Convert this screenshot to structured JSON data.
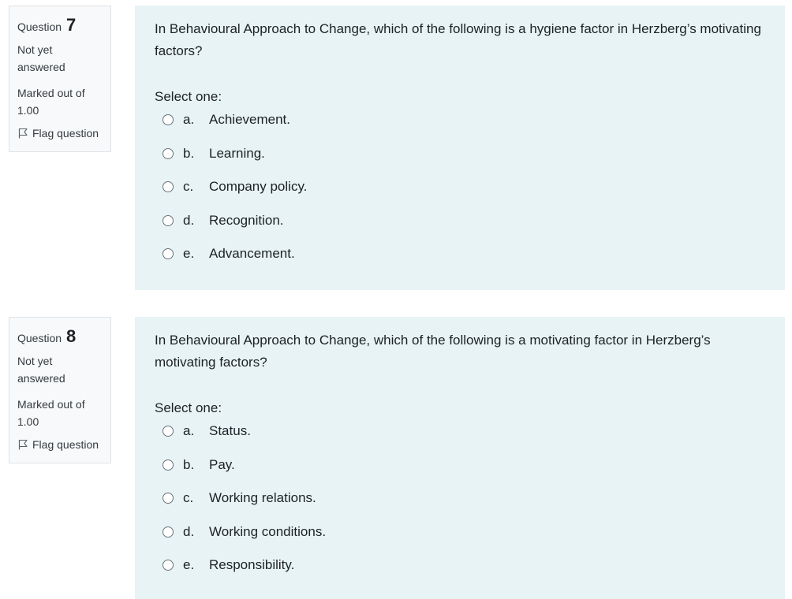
{
  "questions": [
    {
      "word": "Question",
      "number": "7",
      "state": "Not yet answered",
      "grade": "Marked out of 1.00",
      "flag_label": "Flag question",
      "text": "In Behavioural Approach to Change, which of the following is a hygiene factor in Herzberg’s motivating factors?",
      "prompt": "Select one:",
      "answers": [
        {
          "letter": "a.",
          "text": "Achievement."
        },
        {
          "letter": "b.",
          "text": "Learning."
        },
        {
          "letter": "c.",
          "text": "Company policy."
        },
        {
          "letter": "d.",
          "text": "Recognition."
        },
        {
          "letter": "e.",
          "text": "Advancement."
        }
      ]
    },
    {
      "word": "Question",
      "number": "8",
      "state": "Not yet answered",
      "grade": "Marked out of 1.00",
      "flag_label": "Flag question",
      "text": "In Behavioural Approach to Change, which of the following is a motivating factor in Herzberg’s motivating factors?",
      "prompt": "Select one:",
      "answers": [
        {
          "letter": "a.",
          "text": "Status."
        },
        {
          "letter": "b.",
          "text": "Pay."
        },
        {
          "letter": "c.",
          "text": "Working relations."
        },
        {
          "letter": "d.",
          "text": "Working conditions."
        },
        {
          "letter": "e.",
          "text": "Responsibility."
        }
      ]
    }
  ],
  "colors": {
    "content_background": "#e7f3f5",
    "info_background": "#f8f9fa",
    "info_border": "#dee2e6",
    "text": "#1d2125"
  },
  "icons": {
    "flag": "flag-icon",
    "radio": "radio-button"
  }
}
